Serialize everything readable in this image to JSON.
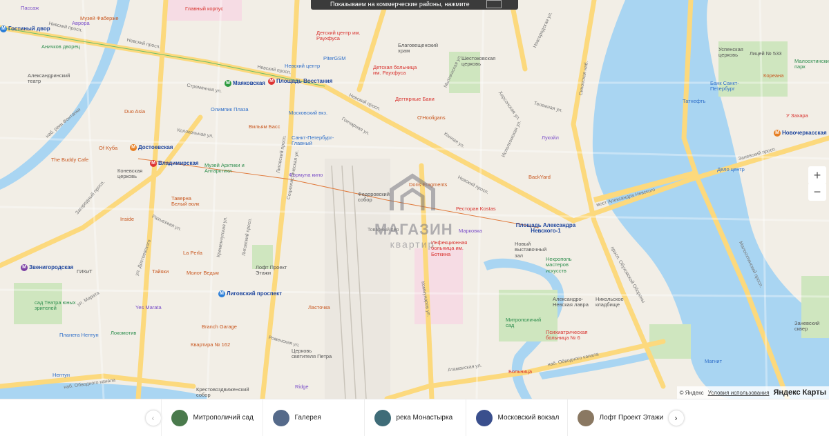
{
  "banner": {
    "text": "Показываем на коммерческие районы, нажмите"
  },
  "watermark": {
    "line1": "МАГАЗИН",
    "line2": "квартир"
  },
  "metro_stations": [
    {
      "name": "Маяковская"
    },
    {
      "name": "Площадь Восстания"
    },
    {
      "name": "Достоевская"
    },
    {
      "name": "Владимирская"
    },
    {
      "name": "Звенигородская"
    },
    {
      "name": "Лиговский проспект"
    },
    {
      "name": "Площадь Александра Невского-1"
    },
    {
      "name": "Новочеркасская"
    },
    {
      "name": "Гостиный двор"
    }
  ],
  "pois": [
    {
      "name": "Главный корпус"
    },
    {
      "name": "Музей Фаберже"
    },
    {
      "name": "Аврора"
    },
    {
      "name": "Аничков дворец"
    },
    {
      "name": "Александринский театр"
    },
    {
      "name": "Детский центр им. Раухфуса"
    },
    {
      "name": "PiterGSM"
    },
    {
      "name": "Детская больница им. Раухфуса"
    },
    {
      "name": "Невский центр"
    },
    {
      "name": "Благовещенский храм"
    },
    {
      "name": "Шестоковская церковь"
    },
    {
      "name": "Олимпик Плаза"
    },
    {
      "name": "Московский вкз."
    },
    {
      "name": "Дегтярные Бани"
    },
    {
      "name": "O'Hooligans"
    },
    {
      "name": "Duo Asia"
    },
    {
      "name": "Вильям Басс"
    },
    {
      "name": "Санкт-Петербург-Главный"
    },
    {
      "name": "Лукойл"
    },
    {
      "name": "Of Kуба"
    },
    {
      "name": "The Buddy Cafe"
    },
    {
      "name": "Коневская церковь"
    },
    {
      "name": "Музей Арктики и Антарктики"
    },
    {
      "name": "Формула кино"
    },
    {
      "name": "Федоровский собор"
    },
    {
      "name": "Doris Fragments"
    },
    {
      "name": "BackYard"
    },
    {
      "name": "Таверна Белый волк"
    },
    {
      "name": "Ресторан Kostas"
    },
    {
      "name": "Марковка"
    },
    {
      "name": "Inside"
    },
    {
      "name": "Инфекционная больница им. Боткина"
    },
    {
      "name": "Новый выставочный зал"
    },
    {
      "name": "La Perla"
    },
    {
      "name": "ГИКиТ"
    },
    {
      "name": "Тайяки"
    },
    {
      "name": "Молот Ведьм"
    },
    {
      "name": "Лофт Проект Этажи"
    },
    {
      "name": "Некрополь мастеров искусств"
    },
    {
      "name": "Александро-Невская лавра"
    },
    {
      "name": "Никольское кладбище"
    },
    {
      "name": "сад Театра юных зрителей"
    },
    {
      "name": "Yes Marata"
    },
    {
      "name": "Ласточка"
    },
    {
      "name": "Митрополичий сад"
    },
    {
      "name": "Локомотив"
    },
    {
      "name": "Планета Нептун"
    },
    {
      "name": "Branch Garage"
    },
    {
      "name": "Психиатрическая больница № 6"
    },
    {
      "name": "Квартира № 162"
    },
    {
      "name": "Церковь святителя Петра"
    },
    {
      "name": "Нептун"
    },
    {
      "name": "Больница"
    },
    {
      "name": "Крестовоздвиженский собор"
    },
    {
      "name": "Ridge"
    },
    {
      "name": "Успенская церковь"
    },
    {
      "name": "Лицей № 533"
    },
    {
      "name": "Малоохтинский парк"
    },
    {
      "name": "Кореана"
    },
    {
      "name": "Банк Санкт-Петербург"
    },
    {
      "name": "Татнефть"
    },
    {
      "name": "У Захара"
    },
    {
      "name": "Дело центр"
    },
    {
      "name": "Магнит"
    },
    {
      "name": "Заневский сквер"
    },
    {
      "name": "Пассаж"
    }
  ],
  "streets": [
    "Невский просп.",
    "Невский просп.",
    "Невский просп.",
    "Невский просп.",
    "Невский просп.",
    "Лиговский просп.",
    "Лиговский просп.",
    "Гончарная ул.",
    "мост Александра Невского",
    "Заневский просп.",
    "Малоохтинский просп.",
    "наб. Обводного канала",
    "наб. Обводного канала",
    "Синопская наб.",
    "просп. Обуховской Обороны",
    "Загородный просп.",
    "Разъезжая ул.",
    "Кременчугская ул.",
    "Коммунаров ул.",
    "ул. Марата",
    "Роменская ул.",
    "Товарный пер",
    "Атаманская ул.",
    "Исполкомская ул.",
    "Мытнинская ул.",
    "Херсонская ул.",
    "Стремянная ул.",
    "Колокольная ул.",
    "наб. реки Фонтанки",
    "ул. Достоевского",
    "Социалистическая ул.",
    "Новгородская ул.",
    "Тележная ул.",
    "Конная ул."
  ],
  "controls": {
    "zoom_in": "+",
    "zoom_out": "−"
  },
  "copyright": {
    "text": "© Яндекс",
    "terms": "Условия использования",
    "brand_main": "Яндекс",
    "brand_accent": "Карты"
  },
  "gallery": {
    "prev": "‹",
    "next": "›",
    "items": [
      {
        "label": "Митрополичий сад",
        "color": "#4a7a4c"
      },
      {
        "label": "Галерея",
        "color": "#556a8a"
      },
      {
        "label": "река Монастырка",
        "color": "#3f6c78"
      },
      {
        "label": "Московский вокзал",
        "color": "#3a4f8d"
      },
      {
        "label": "Лофт Проект Этажи",
        "color": "#8a7862"
      }
    ]
  }
}
